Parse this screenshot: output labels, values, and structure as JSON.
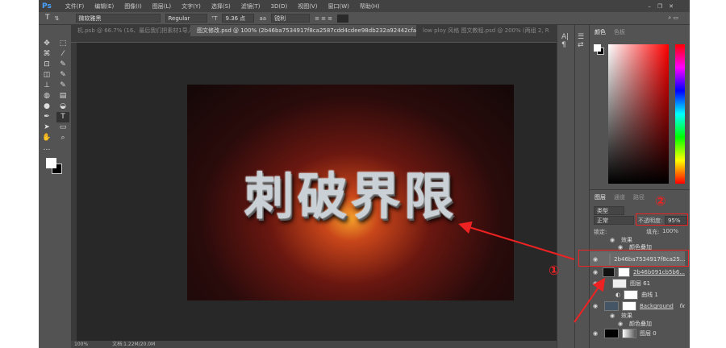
{
  "menu": {
    "logo": "Ps",
    "items": [
      "文件(F)",
      "编辑(E)",
      "图像(I)",
      "图层(L)",
      "文字(Y)",
      "选择(S)",
      "滤镜(T)",
      "3D(D)",
      "视图(V)",
      "窗口(W)",
      "帮助(H)"
    ]
  },
  "options": {
    "font_family": "微软雅黑",
    "font_style": "Regular",
    "font_size": "9.36 点",
    "antialias": "锐利"
  },
  "tabs": [
    "机.psb @ 66.7% (16、最后我们把素材1导入进...",
    "图文修改.psd @ 100% (2b46ba7534917f8ca2587cdd4cdee98db232a92442cfa-rApYl7, RGB/8) *",
    "low ploy 风格 图文教程.psd @ 200% (两组 2, R..."
  ],
  "tools": [
    "✥",
    "⬚",
    "⌘",
    "⁄",
    "⊡",
    "✎",
    "◫",
    "✎",
    "⊥",
    "✎",
    "◍",
    "▤",
    "●",
    "◒",
    "✒",
    "T",
    "➤",
    "▭",
    "✋",
    "⌕",
    "…"
  ],
  "status": {
    "zoom": "100%",
    "doc": "文档:1.22M/20.0M"
  },
  "canvas_text": "刺破界限",
  "color_panel": {
    "tabs": [
      "颜色",
      "色板"
    ]
  },
  "layers_panel": {
    "tabs": [
      "图层",
      "通道",
      "路径"
    ],
    "filter": "类型",
    "blend": "正常",
    "opacity_label": "不透明度:",
    "opacity": "95%",
    "lock_label": "锁定:",
    "fill_label": "填充:",
    "fill": "100%",
    "rows": [
      {
        "name": "效果",
        "type": "effect"
      },
      {
        "name": "颜色叠加",
        "type": "effect"
      },
      {
        "name": "2b46ba7534917f8ca25...",
        "type": "layer"
      },
      {
        "name": "2b46b091cb5b6...",
        "type": "layer"
      },
      {
        "name": "图层 61",
        "type": "layer"
      },
      {
        "name": "曲线 1",
        "type": "layer"
      },
      {
        "name": "Background",
        "type": "layer",
        "fx": "fx"
      },
      {
        "name": "效果",
        "type": "effect"
      },
      {
        "name": "颜色叠加",
        "type": "effect"
      },
      {
        "name": "图层 0",
        "type": "layer"
      }
    ]
  },
  "annotations": {
    "one": "①",
    "two": "②"
  },
  "accent": "#e22222"
}
